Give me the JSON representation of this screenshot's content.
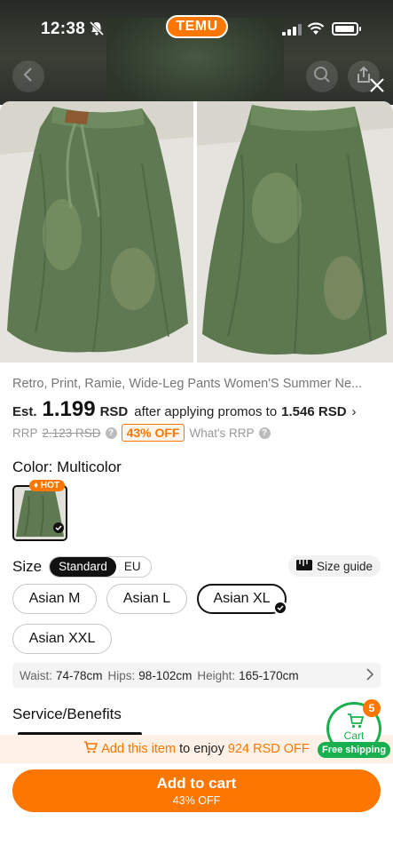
{
  "status_bar": {
    "time": "12:38",
    "brand": "TEMU"
  },
  "icons": {
    "back": "chevron-left-icon",
    "search": "search-icon",
    "share": "share-icon",
    "close": "close-icon",
    "silent": "bell-slash-icon",
    "size_guide": "ruler-icon",
    "cart": "cart-icon",
    "info": "question-circle-icon"
  },
  "product": {
    "title": "Retro, Print, Ramie, Wide-Leg Pants Women'S Summer Ne...",
    "price": {
      "est_label": "Est.",
      "value": "1.199",
      "currency": "RSD",
      "after_text": "after applying promos to",
      "original": "1.546 RSD",
      "chevron": "›"
    },
    "rrp": {
      "label": "RRP",
      "value": "2.123 RSD",
      "discount": "43% OFF",
      "whats_rrp": "What's RRP"
    }
  },
  "color": {
    "label": "Color: Multicolor",
    "hot_badge": "HOT"
  },
  "size": {
    "label": "Size",
    "systems": [
      "Standard",
      "EU"
    ],
    "guide_label": "Size guide",
    "options": [
      "Asian M",
      "Asian L",
      "Asian XL",
      "Asian XXL"
    ],
    "selected": "Asian XL"
  },
  "measurements": [
    {
      "key": "Waist:",
      "value": "74-78cm"
    },
    {
      "key": "Hips:",
      "value": "98-102cm"
    },
    {
      "key": "Height:",
      "value": "165-170cm"
    }
  ],
  "service": {
    "heading": "Service/Benefits"
  },
  "promo": {
    "part1": "Add this item",
    "part2": " to enjoy ",
    "part3": "924 RSD OFF"
  },
  "cta": {
    "label": "Add to cart",
    "sub": "43% OFF"
  },
  "cart": {
    "label": "Cart",
    "count": "5",
    "free_shipping": "Free shipping"
  },
  "colors": {
    "accent": "#fb7701",
    "green": "#18b04e",
    "dark": "#111111"
  }
}
